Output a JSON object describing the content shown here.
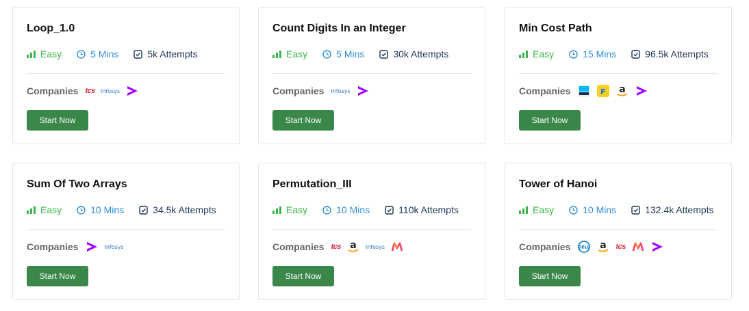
{
  "colors": {
    "easy": "#3bb44a",
    "time": "#2f8fdc",
    "attempts": "#1d3557",
    "button": "#3b874a"
  },
  "companies_label": "Companies",
  "start_label": "Start Now",
  "cards": [
    {
      "title": "Loop_1.0",
      "difficulty": "Easy",
      "time": "5 Mins",
      "attempts": "5k Attempts",
      "companies": [
        "tcs",
        "infosys",
        "accenture"
      ]
    },
    {
      "title": "Count Digits In an Integer",
      "difficulty": "Easy",
      "time": "5 Mins",
      "attempts": "30k Attempts",
      "companies": [
        "infosys",
        "accenture"
      ]
    },
    {
      "title": "Min Cost Path",
      "difficulty": "Easy",
      "time": "15 Mins",
      "attempts": "96.5k Attempts",
      "companies": [
        "paytm",
        "flipkart",
        "amazon",
        "accenture"
      ]
    },
    {
      "title": "Sum Of Two Arrays",
      "difficulty": "Easy",
      "time": "10 Mins",
      "attempts": "34.5k Attempts",
      "companies": [
        "accenture",
        "infosys"
      ]
    },
    {
      "title": "Permutation_III",
      "difficulty": "Easy",
      "time": "10 Mins",
      "attempts": "110k Attempts",
      "companies": [
        "tcs",
        "amazon",
        "infosys",
        "myntra"
      ]
    },
    {
      "title": "Tower of Hanoi",
      "difficulty": "Easy",
      "time": "10 Mins",
      "attempts": "132.4k Attempts",
      "companies": [
        "dell",
        "amazon",
        "tcs",
        "myntra",
        "accenture"
      ]
    }
  ]
}
